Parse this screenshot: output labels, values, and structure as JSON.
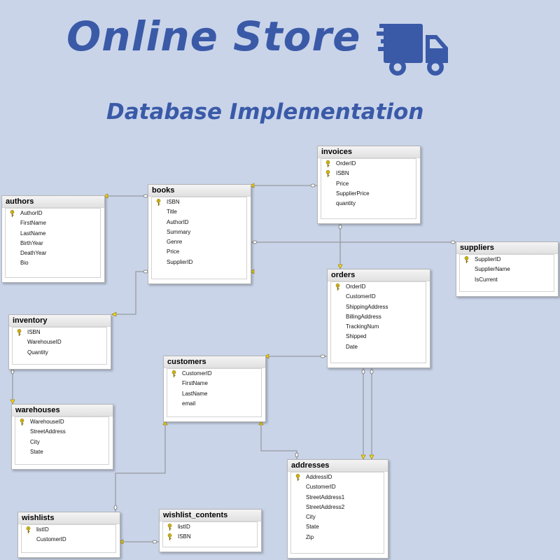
{
  "title": "Online Store",
  "subtitle": "Database Implementation",
  "icons": {
    "header": "delivery-truck-icon",
    "primary_key": "key-icon"
  },
  "colors": {
    "background": "#c9d4e9",
    "title": "#3a5aa8",
    "key": "#f2d31b",
    "connector": "#8c8c8c"
  },
  "entities": [
    {
      "id": "authors",
      "name": "authors",
      "fields": [
        {
          "name": "AuthorID",
          "pk": true
        },
        {
          "name": "FirstName",
          "pk": false
        },
        {
          "name": "LastName",
          "pk": false
        },
        {
          "name": "BirthYear",
          "pk": false
        },
        {
          "name": "DeathYear",
          "pk": false
        },
        {
          "name": "Bio",
          "pk": false
        }
      ]
    },
    {
      "id": "books",
      "name": "books",
      "fields": [
        {
          "name": "ISBN",
          "pk": true
        },
        {
          "name": "Title",
          "pk": false
        },
        {
          "name": "AuthorID",
          "pk": false
        },
        {
          "name": "Summary",
          "pk": false
        },
        {
          "name": "Genre",
          "pk": false
        },
        {
          "name": "Price",
          "pk": false
        },
        {
          "name": "SupplierID",
          "pk": false
        }
      ]
    },
    {
      "id": "invoices",
      "name": "invoices",
      "fields": [
        {
          "name": "OrderID",
          "pk": true
        },
        {
          "name": "ISBN",
          "pk": true
        },
        {
          "name": "Price",
          "pk": false
        },
        {
          "name": "SupplierPrice",
          "pk": false
        },
        {
          "name": "quantity",
          "pk": false
        }
      ]
    },
    {
      "id": "suppliers",
      "name": "suppliers",
      "fields": [
        {
          "name": "SupplierID",
          "pk": true
        },
        {
          "name": "SupplierName",
          "pk": false
        },
        {
          "name": "IsCurrent",
          "pk": false
        }
      ]
    },
    {
      "id": "orders",
      "name": "orders",
      "fields": [
        {
          "name": "OrderID",
          "pk": true
        },
        {
          "name": "CustomerID",
          "pk": false
        },
        {
          "name": "ShippingAddress",
          "pk": false
        },
        {
          "name": "BillingAddress",
          "pk": false
        },
        {
          "name": "TrackingNum",
          "pk": false
        },
        {
          "name": "Shipped",
          "pk": false
        },
        {
          "name": "Date",
          "pk": false
        }
      ]
    },
    {
      "id": "inventory",
      "name": "inventory",
      "fields": [
        {
          "name": "ISBN",
          "pk": true
        },
        {
          "name": "WarehouseID",
          "pk": false
        },
        {
          "name": "Quantity",
          "pk": false
        }
      ]
    },
    {
      "id": "customers",
      "name": "customers",
      "fields": [
        {
          "name": "CustomerID",
          "pk": true
        },
        {
          "name": "FirstName",
          "pk": false
        },
        {
          "name": "LastName",
          "pk": false
        },
        {
          "name": "email",
          "pk": false
        }
      ]
    },
    {
      "id": "warehouses",
      "name": "warehouses",
      "fields": [
        {
          "name": "WarehouseID",
          "pk": true
        },
        {
          "name": "StreetAddress",
          "pk": false
        },
        {
          "name": "City",
          "pk": false
        },
        {
          "name": "State",
          "pk": false
        }
      ]
    },
    {
      "id": "addresses",
      "name": "addresses",
      "fields": [
        {
          "name": "AddressID",
          "pk": true
        },
        {
          "name": "CustomerID",
          "pk": false
        },
        {
          "name": "StreetAddress1",
          "pk": false
        },
        {
          "name": "StreetAddress2",
          "pk": false
        },
        {
          "name": "City",
          "pk": false
        },
        {
          "name": "State",
          "pk": false
        },
        {
          "name": "Zip",
          "pk": false
        }
      ]
    },
    {
      "id": "wishlists",
      "name": "wishlists",
      "fields": [
        {
          "name": "listID",
          "pk": true
        },
        {
          "name": "CustomerID",
          "pk": false
        }
      ]
    },
    {
      "id": "wishlist_contents",
      "name": "wishlist_contents",
      "fields": [
        {
          "name": "listID",
          "pk": true
        },
        {
          "name": "ISBN",
          "pk": true
        }
      ]
    }
  ],
  "relationships": [
    {
      "from": "books",
      "to": "authors"
    },
    {
      "from": "books",
      "to": "invoices"
    },
    {
      "from": "books",
      "to": "suppliers"
    },
    {
      "from": "books",
      "to": "inventory"
    },
    {
      "from": "invoices",
      "to": "orders"
    },
    {
      "from": "orders",
      "to": "customers"
    },
    {
      "from": "orders",
      "to": "addresses"
    },
    {
      "from": "inventory",
      "to": "warehouses"
    },
    {
      "from": "customers",
      "to": "addresses"
    },
    {
      "from": "customers",
      "to": "wishlists"
    },
    {
      "from": "wishlists",
      "to": "wishlist_contents"
    }
  ]
}
